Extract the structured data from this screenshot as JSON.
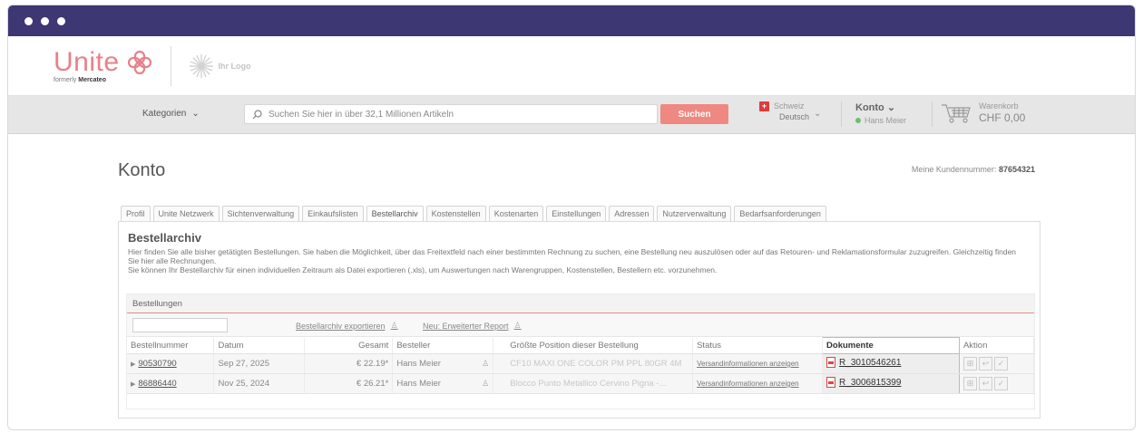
{
  "logo": {
    "word": "Unite",
    "formerly": "formerly",
    "brand": "Mercateo",
    "partner": "Ihr Logo"
  },
  "nav": {
    "categories": "Kategorien",
    "search_placeholder": "Suchen Sie hier in über 32,1 Millionen Artikeln",
    "search_button": "Suchen",
    "country": "Schweiz",
    "language": "Deutsch",
    "account": "Konto",
    "user": "Hans Meier",
    "cart_label": "Warenkorb",
    "cart_total": "CHF 0,00"
  },
  "page": {
    "title": "Konto",
    "customer_label": "Meine Kundennummer:",
    "customer_number": "87654321"
  },
  "tabs": [
    "Profil",
    "Unite Netzwerk",
    "Sichtenverwaltung",
    "Einkaufslisten",
    "Bestellarchiv",
    "Kostenstellen",
    "Kostenarten",
    "Einstellungen",
    "Adressen",
    "Nutzerverwaltung",
    "Bedarfsanforderungen"
  ],
  "active_tab": "Bestellarchiv",
  "archive": {
    "heading": "Bestellarchiv",
    "desc1": "Hier finden Sie alle bisher getätigten Bestellungen. Sie haben die Möglichkeit, über das Freitextfeld nach einer bestimmten Rechnung zu suchen, eine Bestellung neu auszulösen oder auf das Retouren- und Reklamationsformular zuzugreifen. Gleichzeitig finden Sie hier alle Rechnungen.",
    "desc2": "Sie können Ihr Bestellarchiv für einen individuellen Zeitraum als Datei exportieren (.xls), um Auswertungen nach Warengruppen, Kostenstellen, Bestellern etc. vorzunehmen.",
    "section": "Bestellungen",
    "export_link": "Bestellarchiv exportieren",
    "report_link": "Neu: Erweiterter Report"
  },
  "table": {
    "headers": [
      "Bestellnummer",
      "Datum",
      "Gesamt",
      "Besteller",
      "Größte Position dieser Bestellung",
      "Status",
      "Dokumente",
      "Aktion"
    ],
    "rows": [
      {
        "order": "90530790",
        "date": "Sep 27, 2025",
        "total": "€ 22.19*",
        "buyer": "Hans Meier",
        "item": "CF10 MAXI ONE COLOR PM PPL 80GR 4M",
        "status": "Versandinformationen anzeigen",
        "doc": "R_3010546261"
      },
      {
        "order": "86886440",
        "date": "Nov 25, 2024",
        "total": "€ 26.21*",
        "buyer": "Hans Meier",
        "item": "Blocco Punto Metallico Cervino Pigna -...",
        "status": "Versandinformationen anzeigen",
        "doc": "R_3006815399"
      }
    ]
  },
  "colors": {
    "titlebar": "#3d3773",
    "brand_pink": "#e8808a",
    "search_button": "#ee8880"
  }
}
